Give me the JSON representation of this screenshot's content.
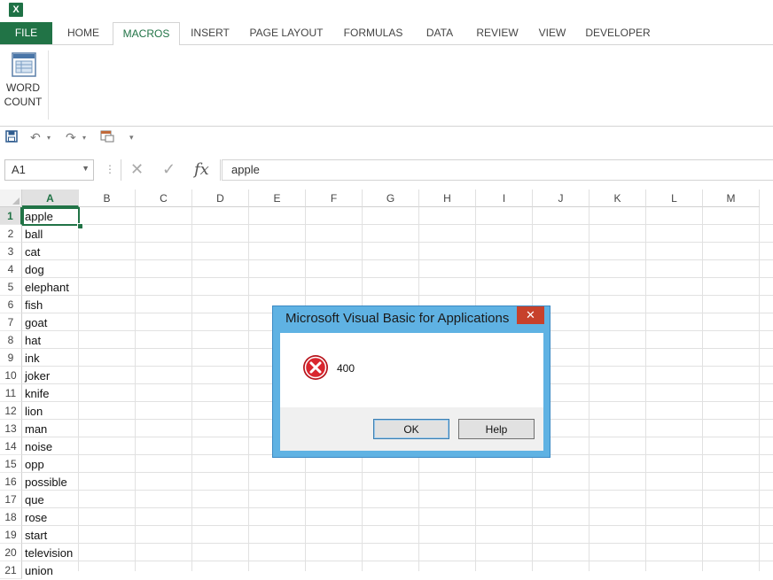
{
  "ribbon": {
    "tabs": [
      "FILE",
      "HOME",
      "MACROS",
      "INSERT",
      "PAGE LAYOUT",
      "FORMULAS",
      "DATA",
      "REVIEW",
      "VIEW",
      "DEVELOPER"
    ],
    "active_tab": "MACROS",
    "word_count_line1": "WORD",
    "word_count_line2": "COUNT"
  },
  "formula_bar": {
    "name_box": "A1",
    "fx_label": "fx",
    "cancel_glyph": "✕",
    "enter_glyph": "✓",
    "content": "apple"
  },
  "grid": {
    "columns": [
      "A",
      "B",
      "C",
      "D",
      "E",
      "F",
      "G",
      "H",
      "I",
      "J",
      "K",
      "L",
      "M"
    ],
    "rows": [
      "1",
      "2",
      "3",
      "4",
      "5",
      "6",
      "7",
      "8",
      "9",
      "10",
      "11",
      "12",
      "13",
      "14",
      "15",
      "16",
      "17",
      "18",
      "19",
      "20",
      "21"
    ],
    "column_a": [
      "apple",
      "ball",
      "cat",
      "dog",
      "elephant",
      "fish",
      "goat",
      "hat",
      "ink",
      "joker",
      "knife",
      "lion",
      "man",
      "noise",
      "opp",
      "possible",
      "que",
      "rose",
      "start",
      "television",
      "union"
    ],
    "selected_cell": "A1"
  },
  "dialog": {
    "title": "Microsoft Visual Basic for Applications",
    "message": "400",
    "ok_label": "OK",
    "help_label": "Help",
    "close_glyph": "✕",
    "icon": "error-icon"
  },
  "colors": {
    "excel_green": "#217346",
    "dialog_frame": "#5fb2e3",
    "close_red": "#c7412b"
  }
}
